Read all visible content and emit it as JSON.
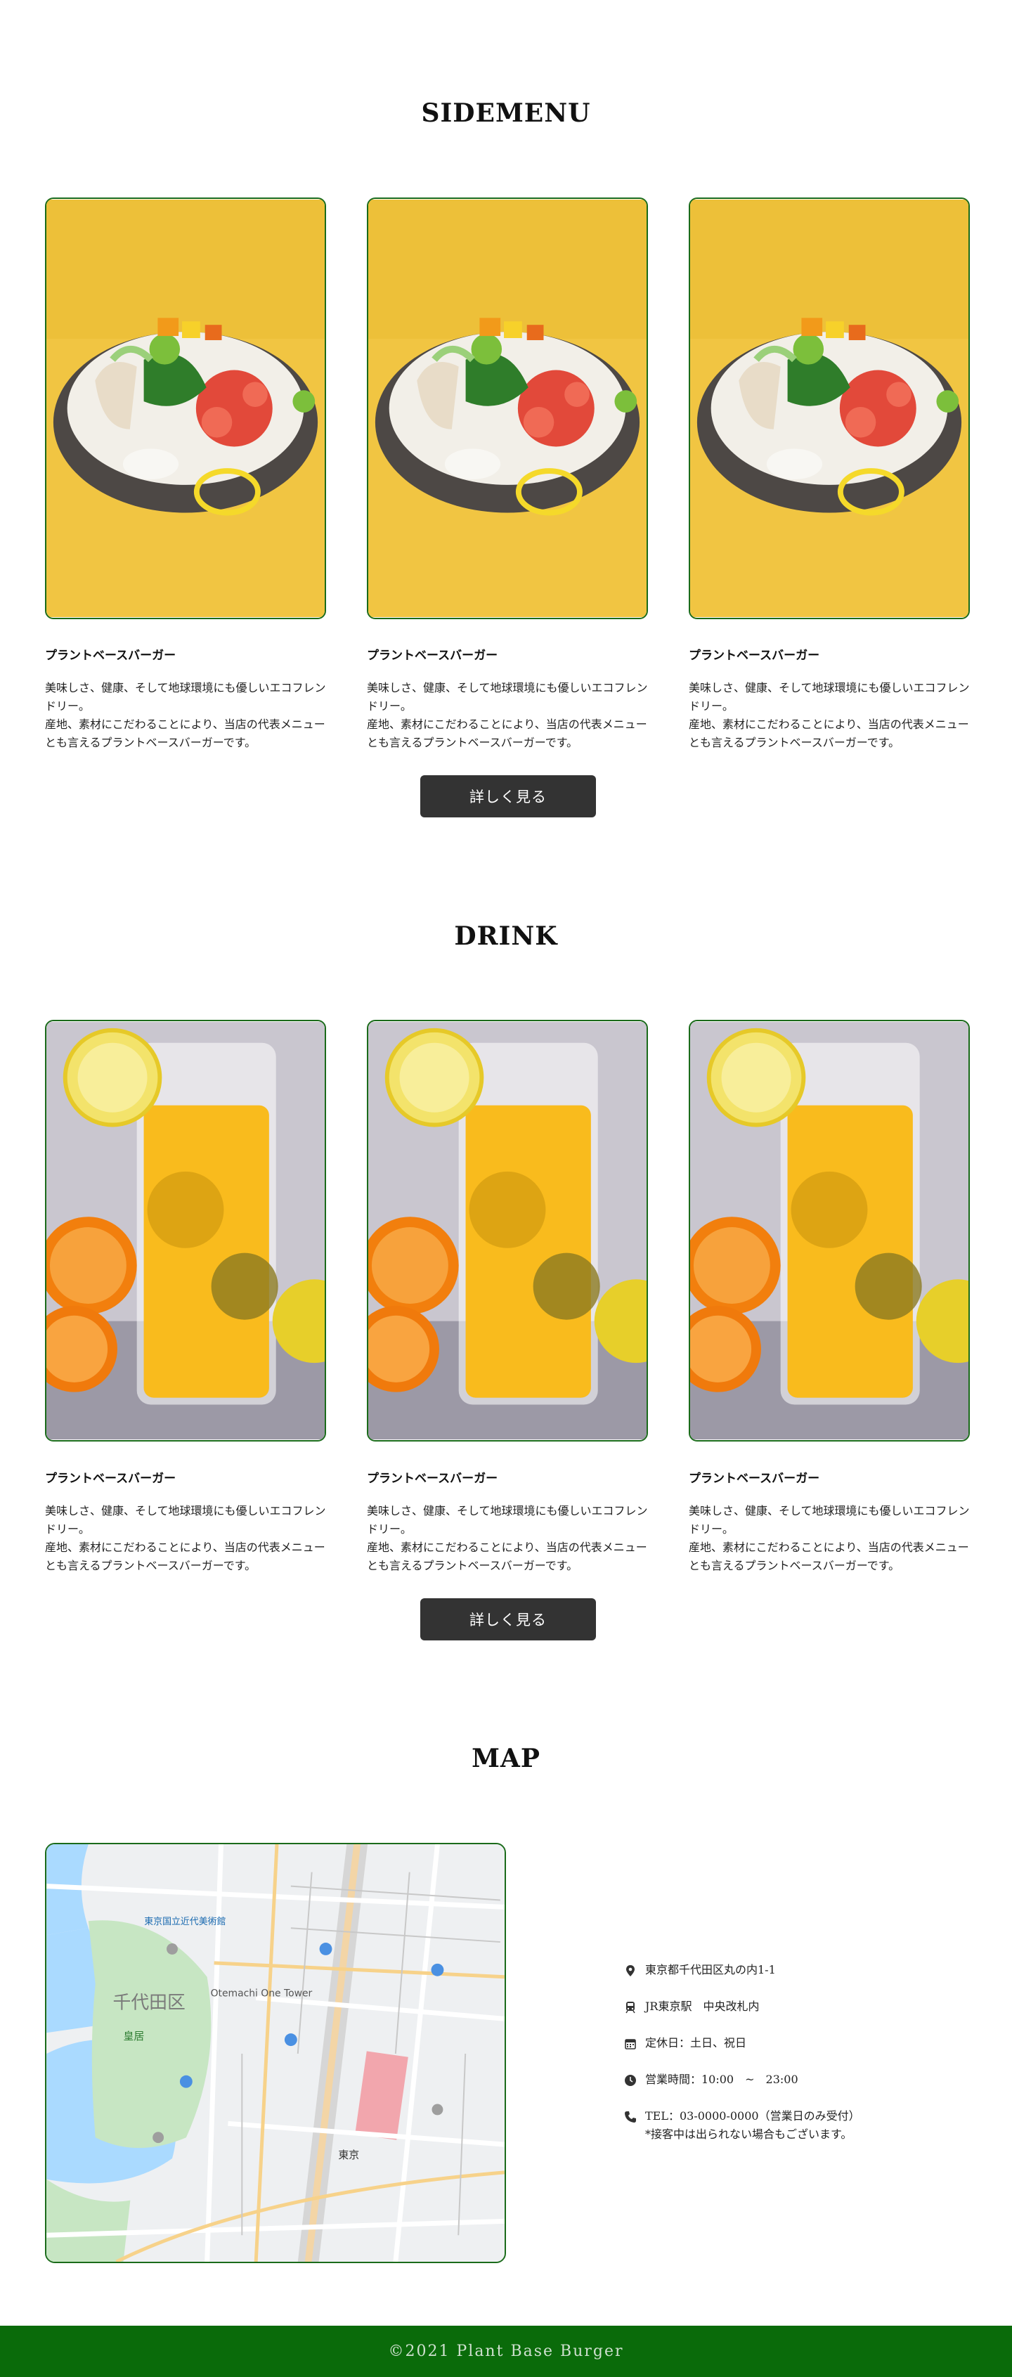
{
  "sidemenu": {
    "title": "SIDEMENU",
    "cards": [
      {
        "title": "プラントベースバーガー",
        "desc_line1": "美味しさ、健康、そして地球環境にも優しいエコフレンドリー。",
        "desc_line2": "産地、素材にこだわることにより、当店の代表メニューとも言えるプラントベースバーガーです。"
      },
      {
        "title": "プラントベースバーガー",
        "desc_line1": "美味しさ、健康、そして地球環境にも優しいエコフレンドリー。",
        "desc_line2": "産地、素材にこだわることにより、当店の代表メニューとも言えるプラントベースバーガーです。"
      },
      {
        "title": "プラントベースバーガー",
        "desc_line1": "美味しさ、健康、そして地球環境にも優しいエコフレンドリー。",
        "desc_line2": "産地、素材にこだわることにより、当店の代表メニューとも言えるプラントベースバーガーです。"
      }
    ],
    "button_label": "詳しく見る"
  },
  "drink": {
    "title": "DRINK",
    "cards": [
      {
        "title": "プラントベースバーガー",
        "desc_line1": "美味しさ、健康、そして地球環境にも優しいエコフレンドリー。",
        "desc_line2": "産地、素材にこだわることにより、当店の代表メニューとも言えるプラントベースバーガーです。"
      },
      {
        "title": "プラントベースバーガー",
        "desc_line1": "美味しさ、健康、そして地球環境にも優しいエコフレンドリー。",
        "desc_line2": "産地、素材にこだわることにより、当店の代表メニューとも言えるプラントベースバーガーです。"
      },
      {
        "title": "プラントベースバーガー",
        "desc_line1": "美味しさ、健康、そして地球環境にも優しいエコフレンドリー。",
        "desc_line2": "産地、素材にこだわることにより、当店の代表メニューとも言えるプラントベースバーガーです。"
      }
    ],
    "button_label": "詳しく見る"
  },
  "map": {
    "title": "MAP",
    "labels": {
      "district": "千代田区",
      "tower": "Otemachi One Tower",
      "station": "東京",
      "palace": "皇居",
      "museum": "東京国立近代美術館"
    },
    "info": {
      "address": "東京都千代田区丸の内1-1",
      "station": "JR東京駅　中央改札内",
      "closed": "定休日：土日、祝日",
      "hours": "営業時間：10:00　~　23:00",
      "tel": "TEL：03-0000-0000（営業日のみ受付）",
      "note": "*接客中は出られない場合もございます。"
    }
  },
  "footer": {
    "copyright": "©2021 Plant Base Burger"
  },
  "colors": {
    "accent_green": "#0a6b0a",
    "card_border": "#1a6b1a",
    "button_bg": "#333333",
    "food_bg": "#f1c542"
  }
}
